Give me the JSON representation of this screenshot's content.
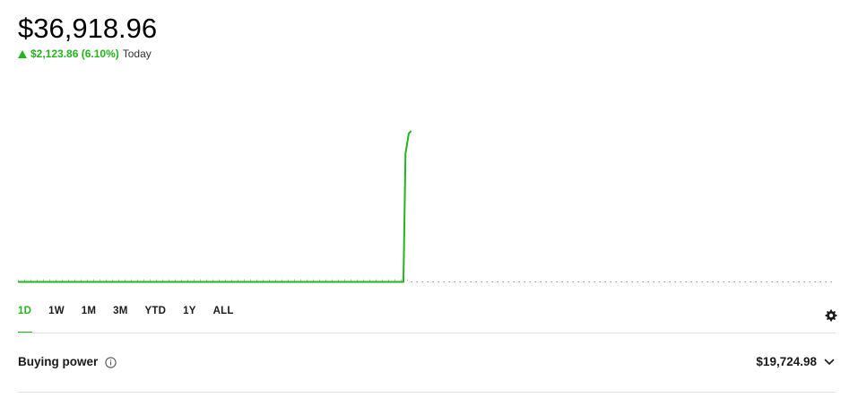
{
  "portfolio": {
    "value": "$36,918.96",
    "change": "$2,123.86 (6.10%)",
    "change_period": "Today",
    "change_direction_icon": "triangle-up-icon"
  },
  "colors": {
    "accent": "#22b51c",
    "text": "#1a1a1a",
    "divider": "#e3e3e3"
  },
  "timeframes": [
    {
      "label": "1D",
      "active": true
    },
    {
      "label": "1W",
      "active": false
    },
    {
      "label": "1M",
      "active": false
    },
    {
      "label": "3M",
      "active": false
    },
    {
      "label": "YTD",
      "active": false
    },
    {
      "label": "1Y",
      "active": false
    },
    {
      "label": "ALL",
      "active": false
    }
  ],
  "settings_icon": "gear-icon",
  "buying_power": {
    "label": "Buying power",
    "info_icon": "info-icon",
    "value": "$19,724.98",
    "expand_icon": "chevron-down-icon"
  },
  "chart_data": {
    "type": "line",
    "title": "",
    "xlabel": "",
    "ylabel": "",
    "grid": false,
    "series": [
      {
        "x": [
          0,
          0.1,
          0.2,
          0.3,
          0.4,
          0.4715,
          0.474,
          0.478,
          0.481
        ],
        "y": [
          34795.1,
          34795.1,
          34795.1,
          34795.1,
          34795.1,
          34795.1,
          36600.0,
          36880.0,
          36918.96
        ]
      }
    ],
    "baseline": 34795.1,
    "ylim": [
      34700,
      37600
    ],
    "xlim": [
      0,
      1
    ]
  }
}
